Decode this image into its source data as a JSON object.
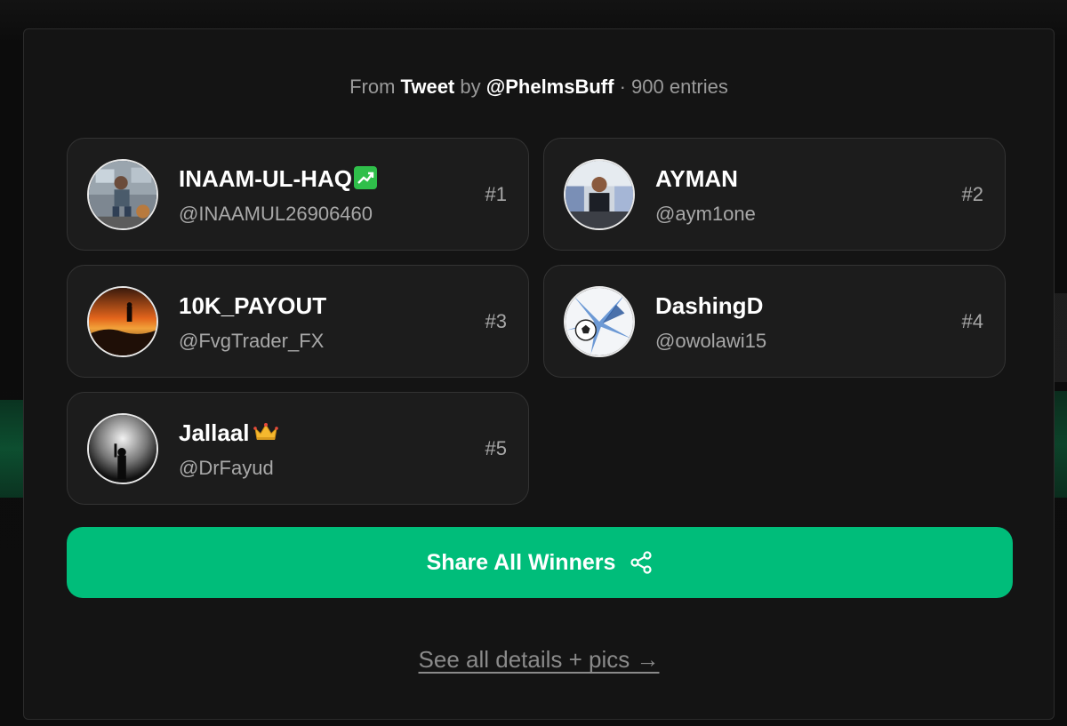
{
  "header": {
    "prefix": "From",
    "source": "Tweet",
    "by": "by",
    "author": "@PhelmsBuff",
    "separator": "·",
    "entries": "900 entries"
  },
  "winners": [
    {
      "name": "INAAM-UL-HAQ",
      "emoji": "chart-increasing-emoji",
      "handle": "@INAAMUL26906460",
      "rank": "#1"
    },
    {
      "name": "AYMAN",
      "handle": "@aym1one",
      "rank": "#2"
    },
    {
      "name": "10K_PAYOUT",
      "handle": "@FvgTrader_FX",
      "rank": "#3"
    },
    {
      "name": "DashingD",
      "handle": "@owolawi15",
      "rank": "#4"
    },
    {
      "name": "Jallaal",
      "emoji": "crown-emoji",
      "handle": "@DrFayud",
      "rank": "#5"
    }
  ],
  "share_button": {
    "label": "Share All Winners",
    "icon": "share-icon"
  },
  "details_link": {
    "label": "See all details + pics →"
  },
  "colors": {
    "accent": "#00bd7a",
    "card_bg": "#1c1c1c",
    "modal_bg": "#141414"
  }
}
